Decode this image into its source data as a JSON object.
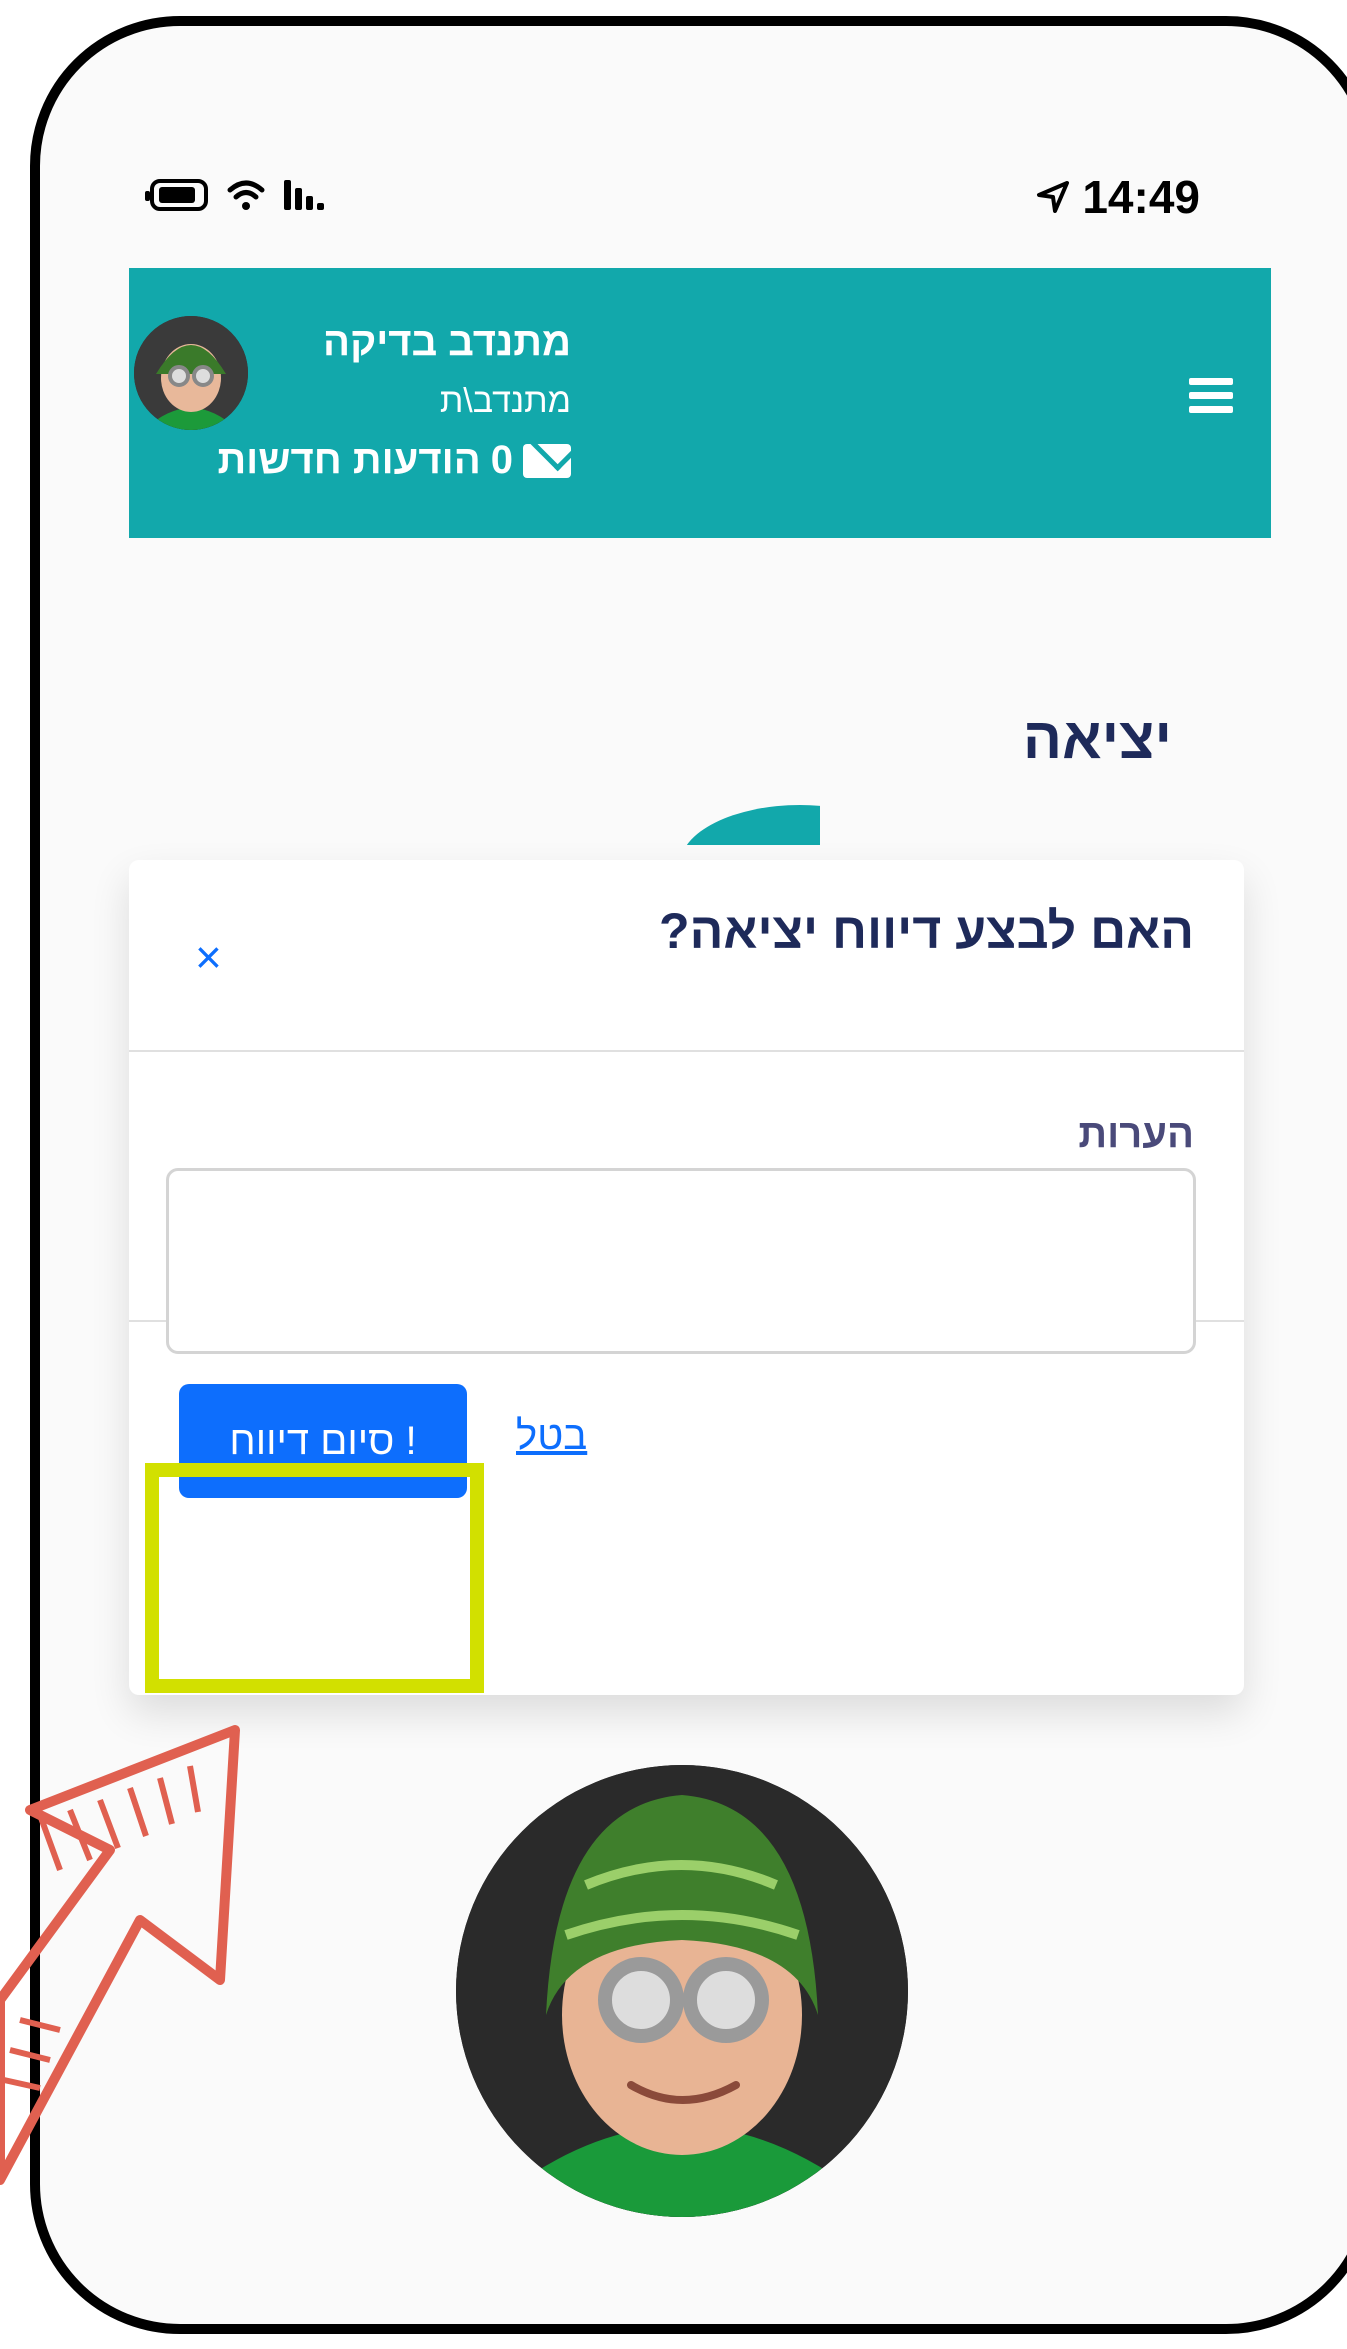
{
  "status_bar": {
    "time": "14:49"
  },
  "header": {
    "user_name": "מתנדב בדיקה",
    "user_role": "מתנדב\\ת",
    "messages_count": "0",
    "messages_label": "הודעות חדשות"
  },
  "page": {
    "title": "יציאה"
  },
  "modal": {
    "title": "האם לבצע דיווח יציאה?",
    "close_symbol": "×",
    "comments_label": "הערות",
    "comments_value": "",
    "finish_button": "סיום דיווח !",
    "cancel_link": "בטל"
  },
  "colors": {
    "header_bg": "#12a8ab",
    "primary": "#0d6efd",
    "highlight": "#d2e000",
    "arrow": "#e06050"
  },
  "icons": [
    "battery-icon",
    "wifi-icon",
    "signal-icon",
    "location-arrow-icon",
    "hamburger-menu-icon",
    "envelope-icon",
    "close-icon"
  ]
}
